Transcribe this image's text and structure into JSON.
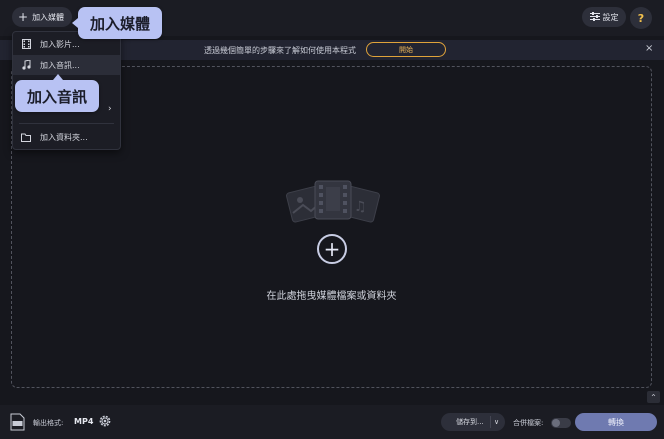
{
  "toolbar": {
    "add_media_label": "加入媒體",
    "settings_label": "設定",
    "help_label": "?"
  },
  "callouts": {
    "add_media": "加入媒體",
    "add_audio": "加入音訊"
  },
  "infobar": {
    "text": "透過幾個簡單的步驟來了解如何使用本程式",
    "start_label": "開始",
    "close_label": "×"
  },
  "dropdown": {
    "items": [
      {
        "label": "加入影片...",
        "icon": "film-icon"
      },
      {
        "label": "加入音訊...",
        "icon": "music-note-icon"
      },
      {
        "label": "",
        "icon": "submenu",
        "chevron": "›"
      },
      {
        "label": "加入資料夾...",
        "icon": "folder-icon"
      }
    ]
  },
  "dropzone": {
    "plus": "+",
    "text": "在此處拖曳媒體檔案或資料夾"
  },
  "bottombar": {
    "format_label": "輸出格式:",
    "format_value": "MP4",
    "save_label": "儲存到...",
    "save_dropdown": "∨",
    "merge_label": "合併檔案:",
    "merge_on": false,
    "convert_label": "轉換"
  },
  "scroll_up": "⌃",
  "colors": {
    "background": "#16171d",
    "panel": "#1b1c23",
    "callout": "#b8c2f3",
    "accent_orange": "#e0a33a",
    "convert": "#6f7ab0",
    "help_icon": "#f2c14e"
  }
}
